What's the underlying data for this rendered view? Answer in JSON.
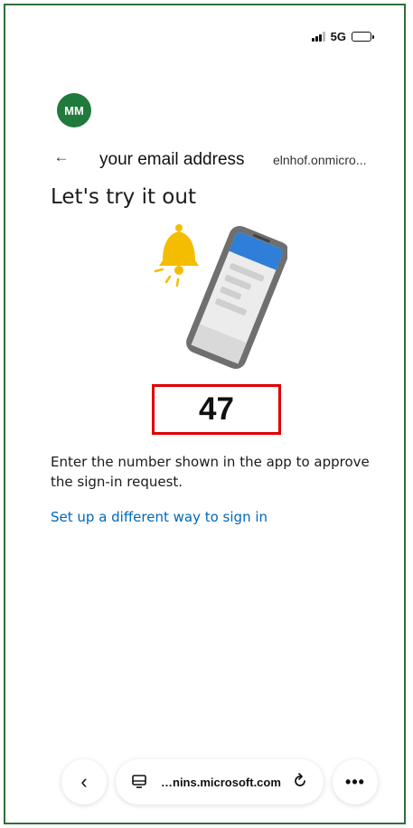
{
  "status_bar": {
    "network": "5G",
    "signal_icon": "signal-bars-icon",
    "battery_icon": "battery-icon"
  },
  "account": {
    "avatar_initials": "MM",
    "avatar_color": "#1f7a3c",
    "email_label": "your email address",
    "domain_text": "elnhof.onmicro..."
  },
  "page": {
    "title": "Let's try it out",
    "number": "47",
    "instructions": "Enter the number shown in the app to approve the sign-in request.",
    "alt_link": "Set up a different way to sign in",
    "link_color": "#0067b8",
    "highlight_color": "#e00000"
  },
  "browser": {
    "url": "…nins.microsoft.com",
    "back_icon": "chevron-left-icon",
    "more_icon": "more-dots-icon",
    "reload_icon": "reload-icon",
    "site_icon": "site-settings-icon"
  }
}
